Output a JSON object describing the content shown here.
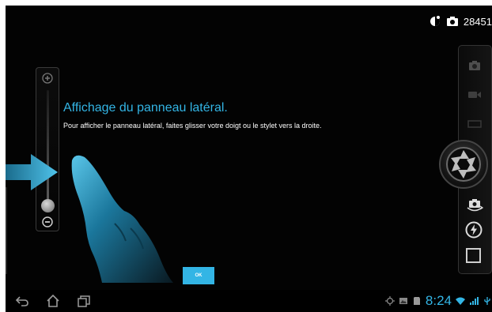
{
  "status": {
    "photo_counter": "28451",
    "white_balance_icon": "white-balance-icon",
    "camera_icon": "camera-icon"
  },
  "zoom": {
    "plus_icon": "zoom-in-icon",
    "minus_icon": "zoom-out-icon",
    "level": 0.08
  },
  "camera_controls": {
    "modes": [
      "camera-mode-icon",
      "video-mode-icon",
      "panorama-mode-icon"
    ],
    "shutter_icon": "shutter-icon",
    "switch_camera_icon": "switch-camera-icon",
    "flash_icon": "flash-auto-icon",
    "stop_icon": "square-icon"
  },
  "tutorial": {
    "title": "Affichage du panneau latéral.",
    "body": "Pour afficher le panneau latéral, faites glisser votre doigt ou le stylet vers la droite.",
    "ok_label": "OK"
  },
  "navbar": {
    "back_icon": "back-icon",
    "home_icon": "home-icon",
    "recents_icon": "recent-apps-icon",
    "clock": "8:24",
    "status_icons": [
      "gps-icon",
      "gallery-icon",
      "sd-card-icon",
      "wifi-icon",
      "signal-icon",
      "usb-icon"
    ]
  },
  "colors": {
    "accent": "#33b5e5",
    "background": "#030303"
  }
}
